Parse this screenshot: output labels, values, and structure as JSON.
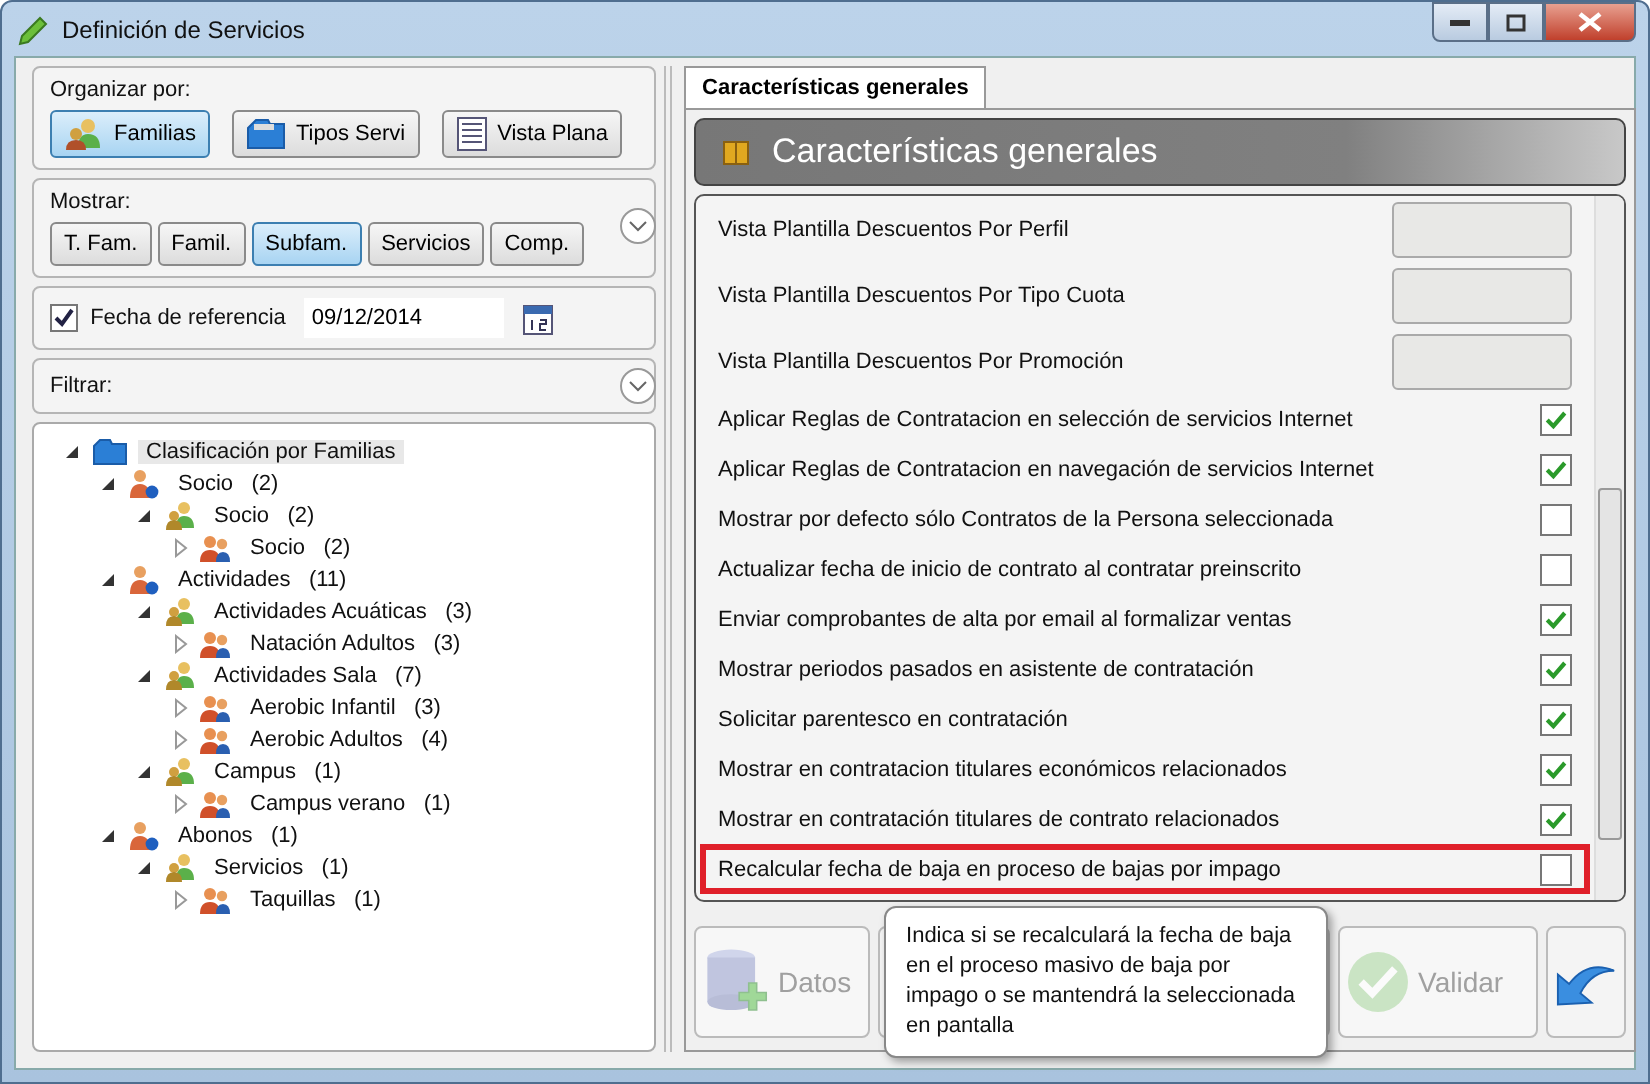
{
  "window": {
    "title": "Definición de Servicios"
  },
  "organize": {
    "label": "Organizar por:",
    "buttons": [
      {
        "label": "Familias",
        "kind": "families",
        "selected": true
      },
      {
        "label": "Tipos Servi",
        "kind": "types",
        "selected": false
      },
      {
        "label": "Vista Plana",
        "kind": "flat",
        "selected": false
      }
    ]
  },
  "show": {
    "label": "Mostrar:",
    "buttons": [
      {
        "label": "T. Fam.",
        "selected": false
      },
      {
        "label": "Famil.",
        "selected": false
      },
      {
        "label": "Subfam.",
        "selected": true
      },
      {
        "label": "Servicios",
        "selected": false
      },
      {
        "label": "Comp.",
        "selected": false
      }
    ]
  },
  "reference_date": {
    "label": "Fecha de referencia",
    "checked": true,
    "value": "09/12/2014"
  },
  "filter": {
    "label": "Filtrar:"
  },
  "tree": [
    {
      "label": "Clasificación por Familias",
      "kind": "root",
      "expanded": true,
      "selected": true,
      "children": [
        {
          "label": "Socio",
          "count": "(2)",
          "kind": "family",
          "expanded": true,
          "selected": false,
          "children": [
            {
              "label": "Socio",
              "count": "(2)",
              "kind": "subfamily",
              "expanded": true,
              "selected": false,
              "children": [
                {
                  "label": "Socio",
                  "count": "(2)",
                  "kind": "service",
                  "expanded": false,
                  "selected": false
                }
              ]
            }
          ]
        },
        {
          "label": "Actividades",
          "count": "(11)",
          "kind": "family",
          "expanded": true,
          "selected": false,
          "children": [
            {
              "label": "Actividades Acuáticas",
              "count": "(3)",
              "kind": "subfamily",
              "expanded": true,
              "selected": false,
              "children": [
                {
                  "label": "Natación Adultos",
                  "count": "(3)",
                  "kind": "service",
                  "expanded": false,
                  "selected": false
                }
              ]
            },
            {
              "label": "Actividades Sala",
              "count": "(7)",
              "kind": "subfamily",
              "expanded": true,
              "selected": false,
              "children": [
                {
                  "label": "Aerobic Infantil",
                  "count": "(3)",
                  "kind": "service",
                  "expanded": false,
                  "selected": false
                },
                {
                  "label": "Aerobic Adultos",
                  "count": "(4)",
                  "kind": "service",
                  "expanded": false,
                  "selected": false
                }
              ]
            },
            {
              "label": "Campus",
              "count": "(1)",
              "kind": "subfamily",
              "expanded": true,
              "selected": false,
              "children": [
                {
                  "label": "Campus verano",
                  "count": "(1)",
                  "kind": "service",
                  "expanded": false,
                  "selected": false
                }
              ]
            }
          ]
        },
        {
          "label": "Abonos",
          "count": "(1)",
          "kind": "family",
          "expanded": true,
          "selected": false,
          "children": [
            {
              "label": "Servicios",
              "count": "(1)",
              "kind": "subfamily",
              "expanded": true,
              "selected": false,
              "children": [
                {
                  "label": "Taquillas",
                  "count": "(1)",
                  "kind": "service",
                  "expanded": false,
                  "selected": false
                }
              ]
            }
          ]
        }
      ]
    }
  ],
  "tabs": [
    {
      "label": "Características generales",
      "selected": true
    }
  ],
  "section": {
    "title": "Características generales"
  },
  "settings": [
    {
      "label": "Vista Plantilla Descuentos Por Perfil",
      "kind": "field",
      "highlighted": false
    },
    {
      "label": "Vista Plantilla Descuentos Por Tipo Cuota",
      "kind": "field",
      "highlighted": false
    },
    {
      "label": "Vista Plantilla Descuentos Por Promoción",
      "kind": "field",
      "highlighted": false
    },
    {
      "label": "Aplicar Reglas de Contratacion en selección de servicios Internet",
      "kind": "check",
      "checked": true,
      "highlighted": false
    },
    {
      "label": "Aplicar Reglas de Contratacion en navegación de servicios Internet",
      "kind": "check",
      "checked": true,
      "highlighted": false
    },
    {
      "label": "Mostrar por defecto sólo Contratos de la Persona seleccionada",
      "kind": "check",
      "checked": false,
      "highlighted": false
    },
    {
      "label": "Actualizar fecha de inicio de contrato al contratar preinscrito",
      "kind": "check",
      "checked": false,
      "highlighted": false
    },
    {
      "label": "Enviar comprobantes de alta por email al formalizar ventas",
      "kind": "check",
      "checked": true,
      "highlighted": false
    },
    {
      "label": "Mostrar periodos pasados en asistente de contratación",
      "kind": "check",
      "checked": true,
      "highlighted": false
    },
    {
      "label": "Solicitar parentesco en contratación",
      "kind": "check",
      "checked": true,
      "highlighted": false
    },
    {
      "label": "Mostrar en contratacion titulares económicos relacionados",
      "kind": "check",
      "checked": true,
      "highlighted": false
    },
    {
      "label": "Mostrar en contratación titulares de contrato relacionados",
      "kind": "check",
      "checked": true,
      "highlighted": false
    },
    {
      "label": "Recalcular fecha de baja en proceso de bajas por impago",
      "kind": "check",
      "checked": false,
      "highlighted": true
    }
  ],
  "actions": [
    {
      "label": "Datos",
      "kind": "database",
      "disabled": true
    },
    {
      "kind": "plain"
    },
    {
      "label": "Validar",
      "kind": "check",
      "disabled": true
    },
    {
      "kind": "undo",
      "disabled": false
    }
  ],
  "tooltip": {
    "text": "Indica si se recalculará la fecha de baja en el proceso masivo de baja por impago o se mantendrá la seleccionada en pantalla"
  }
}
